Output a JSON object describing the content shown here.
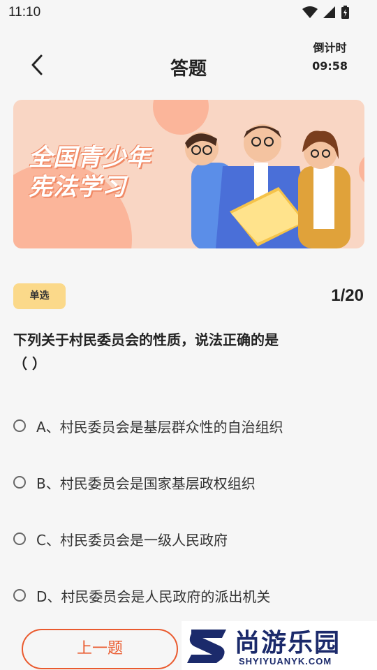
{
  "status_bar": {
    "time": "11:10"
  },
  "header": {
    "title": "答题",
    "countdown_label": "倒计时",
    "countdown_value": "09:58"
  },
  "banner": {
    "line1": "全国青少年",
    "line2": "宪法学习"
  },
  "question": {
    "type_badge": "单选",
    "progress": "1/20",
    "text_line1": "下列关于村民委员会的性质，说法正确的是",
    "text_line2": "（  ）",
    "options": [
      {
        "label": "A、村民委员会是基层群众性的自治组织"
      },
      {
        "label": "B、村民委员会是国家基层政权组织"
      },
      {
        "label": "C、村民委员会是一级人民政府"
      },
      {
        "label": "D、村民委员会是人民政府的派出机关"
      }
    ]
  },
  "footer": {
    "prev_label": "上一题"
  },
  "watermark": {
    "main": "尚游乐园",
    "sub": "SHYIYUANYK.COM"
  },
  "colors": {
    "accent": "#ea5a2e",
    "badge": "#fbd98a",
    "banner_bg": "#f9d6c4"
  }
}
